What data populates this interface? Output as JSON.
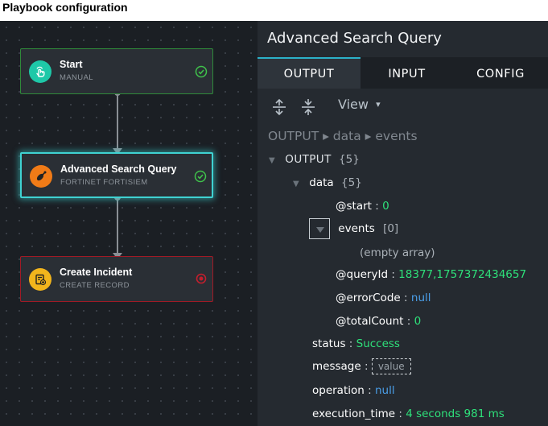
{
  "page": {
    "title": "Playbook configuration"
  },
  "colors": {
    "accent": "#2bb1c8",
    "node_success_border": "#2f8a3a",
    "node_selected_border": "#3fd2d2",
    "node_error_border": "#a11a25",
    "value_green": "#2ee07a",
    "value_null_blue": "#4a9ee8"
  },
  "playbook": {
    "nodes": [
      {
        "title": "Start",
        "subtitle": "MANUAL",
        "icon": "hand-pointer-icon",
        "status": "success"
      },
      {
        "title": "Advanced Search Query",
        "subtitle": "FORTINET FORTISIEM",
        "icon": "satellite-dish-icon",
        "status": "success"
      },
      {
        "title": "Create Incident",
        "subtitle": "CREATE RECORD",
        "icon": "add-record-icon",
        "status": "error"
      }
    ]
  },
  "panel": {
    "title": "Advanced Search Query",
    "tabs": [
      {
        "label": "OUTPUT",
        "active": true
      },
      {
        "label": "INPUT",
        "active": false
      },
      {
        "label": "CONFIG",
        "active": false
      }
    ],
    "toolbar": {
      "expand_icon": "expand-all-icon",
      "collapse_icon": "collapse-all-icon",
      "view_label": "View",
      "view_caret": "▾"
    },
    "breadcrumb": "OUTPUT ▸ data ▸ events",
    "tree": {
      "root_key": "OUTPUT",
      "root_count": "{5}",
      "data_key": "data",
      "data_count": "{5}",
      "start_key": "@start",
      "start_value": "0",
      "events_key": "events",
      "events_count": "[0]",
      "empty_array": "(empty array)",
      "queryid_key": "@queryId",
      "queryid_value": "18377,1757372434657",
      "errorcode_key": "@errorCode",
      "errorcode_value": "null",
      "totalcount_key": "@totalCount",
      "totalcount_value": "0",
      "status_key": "status",
      "status_value": "Success",
      "message_key": "message",
      "message_value": "value",
      "operation_key": "operation",
      "operation_value": "null",
      "exectime_key": "execution_time",
      "exectime_value": "4 seconds 981 ms"
    }
  }
}
